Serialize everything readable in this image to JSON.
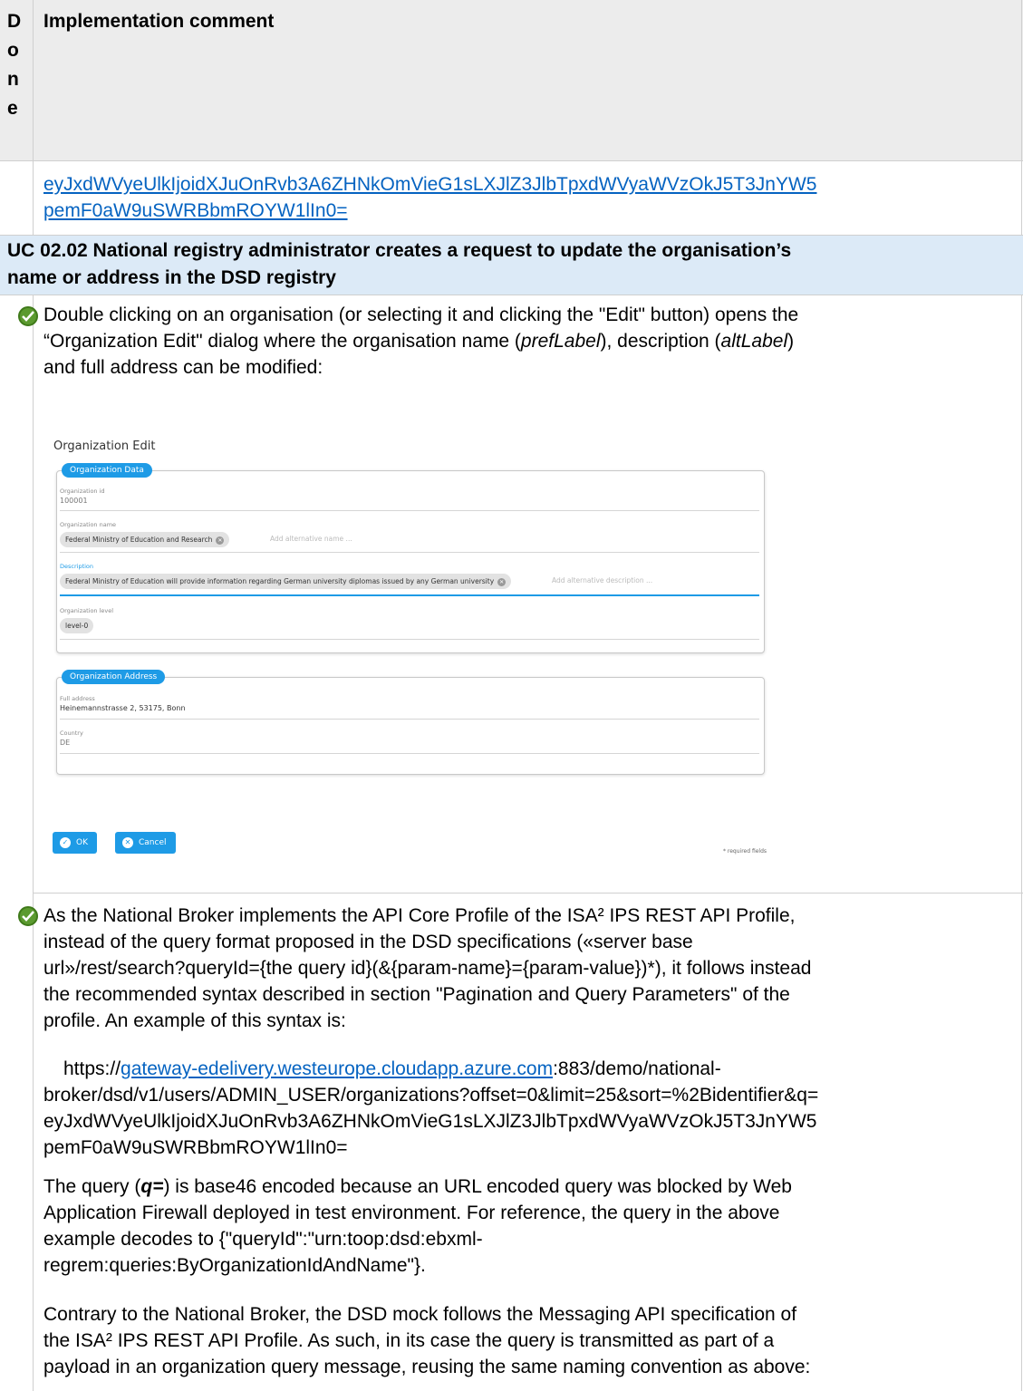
{
  "header": {
    "done_letters": [
      "D",
      "o",
      "n",
      "e"
    ],
    "title": "Implementation comment"
  },
  "query_link": {
    "line1": "eyJxdWVyeUlkIjoidXJuOnRvb3A6ZHNkOmVieG1sLXJlZ3JlbTpxdWVyaWVzOkJ5T3JnYW5",
    "line2": "pemF0aW9uSWRBbmROYW1lIn0="
  },
  "use_case": {
    "title_line1": "UC 02.02 National registry administrator creates a request to update the organisation’s",
    "title_line2": "name or address in the DSD registry"
  },
  "item1": {
    "status_icon": "check-circle-icon",
    "line1": "Double clicking on an organisation (or selecting it and clicking the \"Edit\" button) opens the",
    "line2_a": "“Organization Edit\" dialog where the organisation name (",
    "line2_em1": "prefLabel",
    "line2_b": "), description (",
    "line2_em2": "altLabel",
    "line2_c": ")",
    "line3": "and full address can be modified:"
  },
  "dialog": {
    "title": "Organization Edit",
    "data_section": {
      "legend": "Organization Data",
      "id_label": "Organization id",
      "id_value": "100001",
      "name_label": "Organization name",
      "name_chip": "Federal Ministry of Education and Research",
      "name_placeholder": "Add alternative name ...",
      "desc_label": "Description",
      "desc_chip": "Federal Ministry of Education will provide information regarding German university diplomas issued by any German university",
      "desc_placeholder": "Add alternative description ...",
      "level_label": "Organization level",
      "level_chip": "level-0"
    },
    "address_section": {
      "legend": "Organization Address",
      "address_label": "Full address",
      "address_value": "Heinemannstrasse 2, 53175, Bonn",
      "country_label": "Country",
      "country_value": "DE"
    },
    "ok_label": "OK",
    "cancel_label": "Cancel",
    "required_note": "* required fields"
  },
  "item2": {
    "status_icon": "check-circle-icon",
    "para1": [
      "As the National Broker implements the API Core Profile of the ISA² IPS REST API Profile,",
      "instead of the query format proposed in the DSD specifications («server base",
      "url»/rest/search?queryId={the query id}(&{param-name}={param-value})*), it follows instead",
      "the recommended syntax described in section \"Pagination and Query Parameters\" of the",
      "profile. An example of this syntax is:"
    ],
    "url_prefix": "https://",
    "url_link": "gateway-edelivery.westeurope.cloudapp.azure.com",
    "url_suffix": ":883/demo/national-",
    "url_line2": "broker/dsd/v1/users/ADMIN_USER/organizations?offset=0&limit=25&sort=%2Bidentifier&q=",
    "url_line3": "eyJxdWVyeUlkIjoidXJuOnRvb3A6ZHNkOmVieG1sLXJlZ3JlbTpxdWVyaWVzOkJ5T3JnYW5",
    "url_line4": "pemF0aW9uSWRBbmROYW1lIn0=",
    "para3_a": "The query (",
    "para3_q": "q=",
    "para3_b": ") is base46 encoded because an URL encoded query was blocked by Web",
    "para3_lines": [
      "Application Firewall deployed in test environment. For reference, the query in the above",
      "example decodes to {\"queryId\":\"urn:toop:dsd:ebxml-",
      "regrem:queries:ByOrganizationIdAndName\"}."
    ],
    "para4": [
      "Contrary to the National Broker, the DSD mock follows the Messaging API specification of",
      "the ISA² IPS REST API Profile. As such, in its case the query is transmitted as part of a",
      "payload in an organization query message, reusing the same naming convention as above:"
    ]
  }
}
